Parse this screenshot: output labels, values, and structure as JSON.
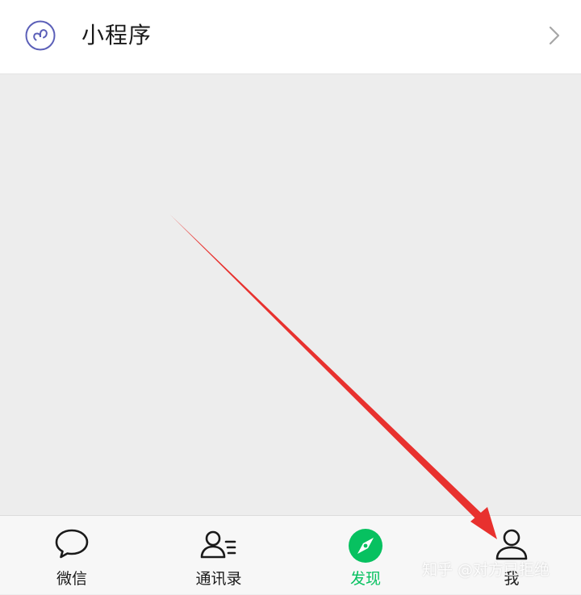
{
  "mini_program_row": {
    "title": "小程序",
    "icon": "mini-program-icon",
    "chevron_icon": "chevron-right-icon"
  },
  "tabbar": {
    "tabs": [
      {
        "label": "微信",
        "icon": "chat-bubble-icon",
        "active": false
      },
      {
        "label": "通讯录",
        "icon": "contacts-icon",
        "active": false
      },
      {
        "label": "发现",
        "icon": "compass-icon",
        "active": true
      },
      {
        "label": "我",
        "icon": "person-icon",
        "active": false
      }
    ]
  },
  "watermark": "知乎 @对方已拒绝",
  "colors": {
    "accent": "#07c160",
    "annotation_arrow": "#e8312e",
    "mini_program_icon": "#5b5fb8"
  }
}
